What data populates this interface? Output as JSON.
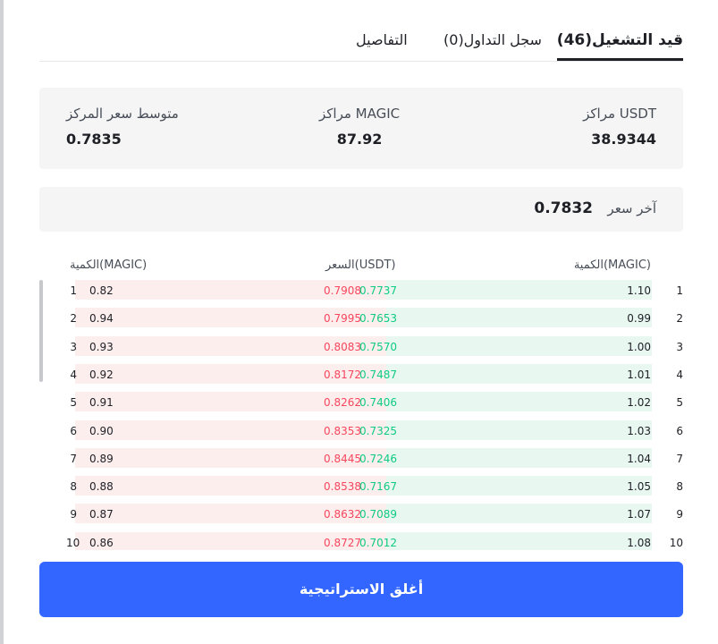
{
  "tabs": [
    {
      "label": "قيد التشغيل(46)",
      "active": true
    },
    {
      "label": "سجل التداول(0)",
      "active": false
    },
    {
      "label": "التفاصيل",
      "active": false
    }
  ],
  "summary": {
    "usdt_position_label": "مراكز USDT",
    "usdt_position_value": "38.9344",
    "magic_position_label": "مراكز MAGIC",
    "magic_position_value": "87.92",
    "avg_price_label": "متوسط سعر المركز",
    "avg_price_value": "0.7835"
  },
  "last_price": {
    "label": "آخر سعر",
    "value": "0.7832"
  },
  "table": {
    "col_qty_buy": "الكمية(MAGIC)",
    "col_price": "السعر(USDT)",
    "col_qty_sell": "الكمية(MAGIC)",
    "rows": [
      {
        "index": "1",
        "buy_qty": "1.10",
        "buy_price": "0.7737",
        "sell_price": "0.7908",
        "sell_qty": "0.82"
      },
      {
        "index": "2",
        "buy_qty": "0.99",
        "buy_price": "0.7653",
        "sell_price": "0.7995",
        "sell_qty": "0.94"
      },
      {
        "index": "3",
        "buy_qty": "1.00",
        "buy_price": "0.7570",
        "sell_price": "0.8083",
        "sell_qty": "0.93"
      },
      {
        "index": "4",
        "buy_qty": "1.01",
        "buy_price": "0.7487",
        "sell_price": "0.8172",
        "sell_qty": "0.92"
      },
      {
        "index": "5",
        "buy_qty": "1.02",
        "buy_price": "0.7406",
        "sell_price": "0.8262",
        "sell_qty": "0.91"
      },
      {
        "index": "6",
        "buy_qty": "1.03",
        "buy_price": "0.7325",
        "sell_price": "0.8353",
        "sell_qty": "0.90"
      },
      {
        "index": "7",
        "buy_qty": "1.04",
        "buy_price": "0.7246",
        "sell_price": "0.8445",
        "sell_qty": "0.89"
      },
      {
        "index": "8",
        "buy_qty": "1.05",
        "buy_price": "0.7167",
        "sell_price": "0.8538",
        "sell_qty": "0.88"
      },
      {
        "index": "9",
        "buy_qty": "1.07",
        "buy_price": "0.7089",
        "sell_price": "0.8632",
        "sell_qty": "0.87"
      },
      {
        "index": "10",
        "buy_qty": "1.08",
        "buy_price": "0.7012",
        "sell_price": "0.8727",
        "sell_qty": "0.86"
      }
    ]
  },
  "close_button": {
    "label": "أغلق الاستراتيجية"
  },
  "colors": {
    "accent": "#3366ff",
    "buy": "#0ecb81",
    "sell": "#f6465d"
  }
}
